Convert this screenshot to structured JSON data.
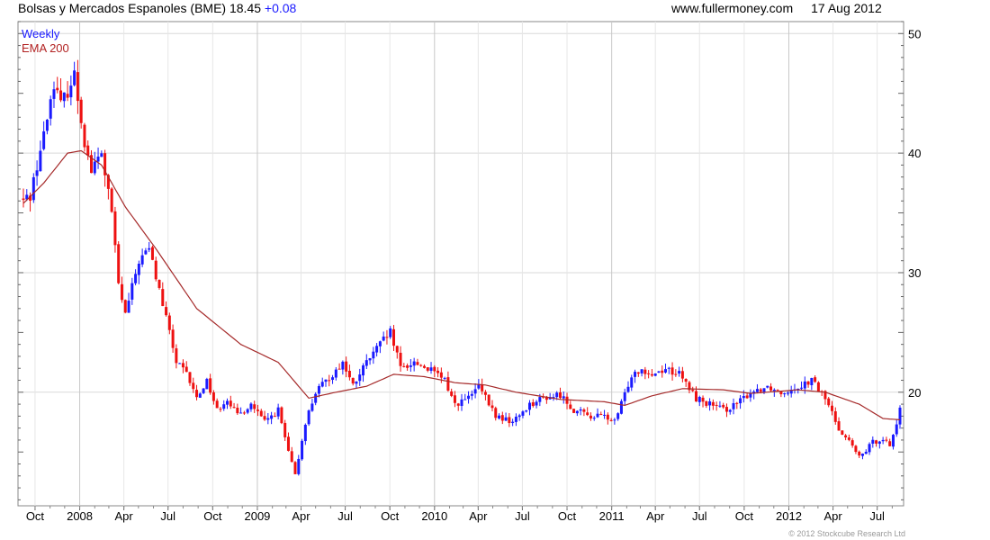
{
  "header": {
    "title": "Bolsas y Mercados Espanoles (BME)",
    "price": "18.45",
    "change": "+0.08",
    "site": "www.fullermoney.com",
    "date": "17 Aug 2012"
  },
  "legend": {
    "series1": "Weekly",
    "series2": "EMA 200"
  },
  "copyright": "© 2012 Stockcube Research Ltd",
  "colors": {
    "up": "#1a1aff",
    "down": "#ee1111",
    "ema": "#a52a2a",
    "grid": "#d9d9d9"
  },
  "chart_data": {
    "type": "candlestick",
    "ylim": [
      10.5,
      51
    ],
    "y_ticks": [
      20,
      30,
      40,
      50
    ],
    "x_ticks": [
      "Oct",
      "2008",
      "Apr",
      "Jul",
      "Oct",
      "2009",
      "Apr",
      "Jul",
      "Oct",
      "2010",
      "Apr",
      "Jul",
      "Oct",
      "2011",
      "Apr",
      "Jul",
      "Oct",
      "2012",
      "Apr",
      "Jul"
    ],
    "grid": true,
    "y_axis_side": "right",
    "close_anchors": [
      [
        "2007-09-07",
        36.0
      ],
      [
        "2007-09-21",
        36.5
      ],
      [
        "2007-10-19",
        41.5
      ],
      [
        "2007-11-09",
        46.0
      ],
      [
        "2007-11-23",
        44.0
      ],
      [
        "2007-12-21",
        46.5
      ],
      [
        "2008-01-11",
        41.0
      ],
      [
        "2008-01-25",
        38.5
      ],
      [
        "2008-02-15",
        40.0
      ],
      [
        "2008-03-07",
        35.0
      ],
      [
        "2008-03-21",
        29.0
      ],
      [
        "2008-04-04",
        26.5
      ],
      [
        "2008-05-02",
        31.0
      ],
      [
        "2008-05-23",
        32.0
      ],
      [
        "2008-06-13",
        28.5
      ],
      [
        "2008-07-04",
        25.0
      ],
      [
        "2008-07-18",
        22.5
      ],
      [
        "2008-08-08",
        21.5
      ],
      [
        "2008-08-29",
        19.5
      ],
      [
        "2008-09-19",
        21.0
      ],
      [
        "2008-10-10",
        18.5
      ],
      [
        "2008-10-31",
        19.5
      ],
      [
        "2008-11-21",
        18.0
      ],
      [
        "2008-12-19",
        19.0
      ],
      [
        "2009-01-16",
        17.5
      ],
      [
        "2009-02-13",
        18.5
      ],
      [
        "2009-03-06",
        15.0
      ],
      [
        "2009-03-20",
        13.0
      ],
      [
        "2009-04-10",
        17.5
      ],
      [
        "2009-05-01",
        20.0
      ],
      [
        "2009-06-05",
        21.5
      ],
      [
        "2009-06-26",
        22.5
      ],
      [
        "2009-07-17",
        20.5
      ],
      [
        "2009-08-14",
        22.5
      ],
      [
        "2009-09-11",
        24.0
      ],
      [
        "2009-10-02",
        25.0
      ],
      [
        "2009-10-23",
        22.0
      ],
      [
        "2009-11-20",
        22.5
      ],
      [
        "2009-12-18",
        22.0
      ],
      [
        "2010-01-22",
        21.0
      ],
      [
        "2010-02-12",
        19.0
      ],
      [
        "2010-03-12",
        19.5
      ],
      [
        "2010-04-02",
        20.5
      ],
      [
        "2010-05-07",
        18.0
      ],
      [
        "2010-06-11",
        17.5
      ],
      [
        "2010-07-16",
        19.0
      ],
      [
        "2010-08-13",
        19.5
      ],
      [
        "2010-09-17",
        19.8
      ],
      [
        "2010-10-15",
        18.5
      ],
      [
        "2010-11-19",
        18.0
      ],
      [
        "2010-12-17",
        18.0
      ],
      [
        "2011-01-07",
        17.5
      ],
      [
        "2011-01-21",
        19.0
      ],
      [
        "2011-02-11",
        21.5
      ],
      [
        "2011-03-04",
        22.0
      ],
      [
        "2011-03-25",
        21.5
      ],
      [
        "2011-04-22",
        22.0
      ],
      [
        "2011-05-20",
        21.5
      ],
      [
        "2011-06-24",
        19.5
      ],
      [
        "2011-07-22",
        19.0
      ],
      [
        "2011-08-19",
        18.5
      ],
      [
        "2011-09-16",
        19.0
      ],
      [
        "2011-10-14",
        20.0
      ],
      [
        "2011-11-18",
        20.5
      ],
      [
        "2011-12-16",
        20.0
      ],
      [
        "2012-01-20",
        20.5
      ],
      [
        "2012-02-17",
        21.0
      ],
      [
        "2012-03-16",
        19.5
      ],
      [
        "2012-04-13",
        17.0
      ],
      [
        "2012-05-11",
        15.5
      ],
      [
        "2012-05-25",
        14.5
      ],
      [
        "2012-06-22",
        15.8
      ],
      [
        "2012-07-13",
        16.2
      ],
      [
        "2012-07-27",
        15.5
      ],
      [
        "2012-08-10",
        17.5
      ],
      [
        "2012-08-17",
        18.45
      ]
    ],
    "ema_anchors": [
      [
        "2007-09-07",
        35.8
      ],
      [
        "2007-10-19",
        37.5
      ],
      [
        "2007-12-07",
        40.0
      ],
      [
        "2008-01-04",
        40.2
      ],
      [
        "2008-02-15",
        39.0
      ],
      [
        "2008-04-04",
        35.5
      ],
      [
        "2008-06-06",
        32.0
      ],
      [
        "2008-08-29",
        27.0
      ],
      [
        "2008-11-28",
        24.0
      ],
      [
        "2009-02-13",
        22.5
      ],
      [
        "2009-04-17",
        19.5
      ],
      [
        "2009-06-12",
        20.0
      ],
      [
        "2009-08-14",
        20.5
      ],
      [
        "2009-10-09",
        21.5
      ],
      [
        "2009-12-11",
        21.3
      ],
      [
        "2010-02-12",
        20.8
      ],
      [
        "2010-04-16",
        20.6
      ],
      [
        "2010-06-18",
        20.0
      ],
      [
        "2010-09-17",
        19.4
      ],
      [
        "2010-12-17",
        19.2
      ],
      [
        "2011-01-28",
        18.9
      ],
      [
        "2011-03-25",
        19.7
      ],
      [
        "2011-05-27",
        20.3
      ],
      [
        "2011-08-19",
        20.2
      ],
      [
        "2011-10-14",
        19.9
      ],
      [
        "2012-01-20",
        20.2
      ],
      [
        "2012-03-16",
        20.0
      ],
      [
        "2012-05-25",
        19.0
      ],
      [
        "2012-07-13",
        17.8
      ],
      [
        "2012-08-17",
        17.7
      ]
    ]
  }
}
